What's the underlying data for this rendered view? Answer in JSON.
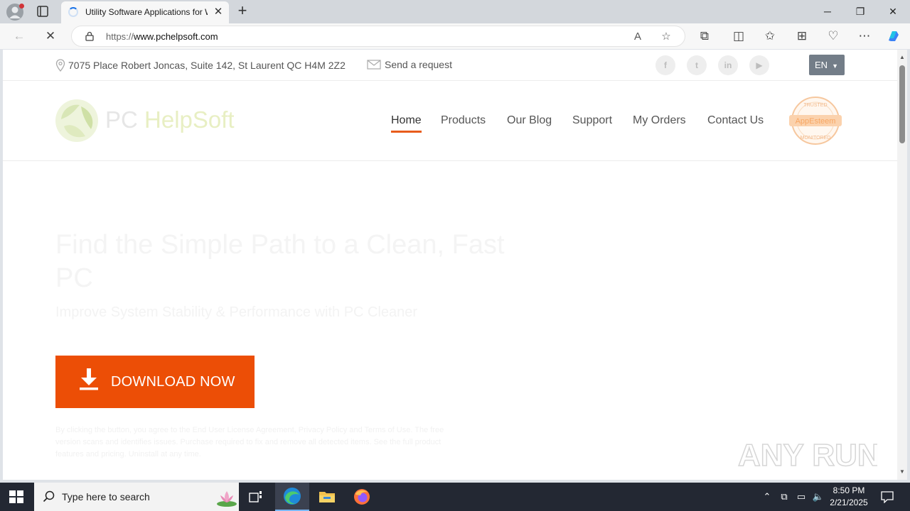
{
  "browser": {
    "tab_title": "Utility Software Applications for Windows",
    "url": "https://www.pchelpsoft.com",
    "url_host": "www.pchelpsoft.com",
    "url_scheme": "https://"
  },
  "site": {
    "topbar": {
      "address": "7075 Place Robert Joncas, Suite 142, St Laurent QC H4M 2Z2",
      "request": "Send a request",
      "language": "EN"
    },
    "logo": {
      "part1": "PC ",
      "part2": "HelpSoft"
    },
    "nav": [
      "Home",
      "Products",
      "Our Blog",
      "Support",
      "My Orders",
      "Contact Us"
    ],
    "badge": {
      "top": "TRUSTED",
      "middle": "AppEsteem",
      "bottom": "MONITORED"
    },
    "hero": {
      "title": "Find the Simple Path to a Clean, Fast PC",
      "subtitle": "Improve System Stability & Performance with PC Cleaner",
      "button": "DOWNLOAD NOW",
      "disclaimer": "By clicking the button, you agree to the End User License Agreement, Privacy Policy and Terms of Use. The free version scans and identifies issues. Purchase required to fix and remove all detected items. See the full product features and pricing. Uninstall at any time."
    },
    "watermark": "ANY RUN"
  },
  "taskbar": {
    "search_placeholder": "Type here to search",
    "time": "8:50 PM",
    "date": "2/21/2025"
  },
  "colors": {
    "accent_orange": "#ec4e06",
    "nav_underline": "#e85c1c",
    "taskbar": "#232833"
  }
}
